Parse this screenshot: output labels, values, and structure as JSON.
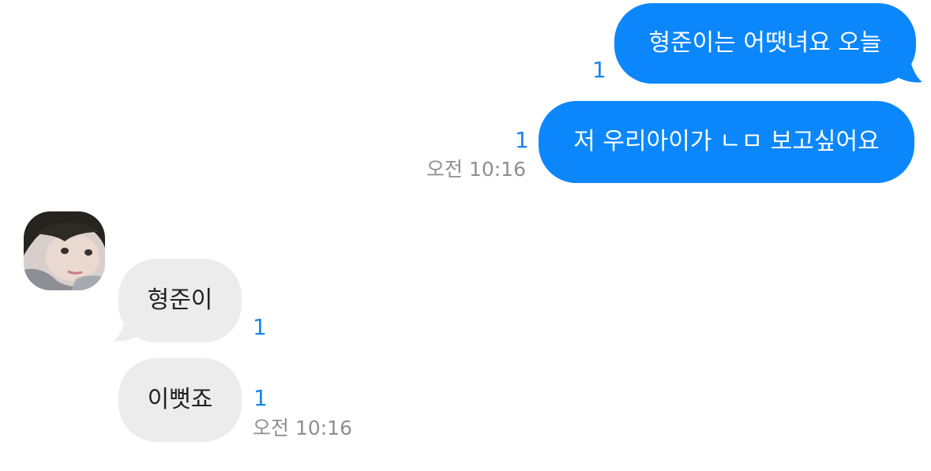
{
  "conversation": {
    "outgoing": [
      {
        "text": "형준이는 어땟녀요 오늘",
        "read": "1"
      },
      {
        "text": "저 우리아이가 ㄴㅁ 보고싶어요",
        "read": "1",
        "time": "오전 10:16"
      }
    ],
    "incoming": [
      {
        "text": "형준이",
        "read": "1"
      },
      {
        "text": "이뻣죠",
        "read": "1",
        "time": "오전 10:16"
      }
    ]
  },
  "colors": {
    "outgoing_bubble": "#0b87fb",
    "incoming_bubble": "#ececed",
    "read_count": "#1a86ea",
    "timestamp": "#8e8e93"
  },
  "icons": {
    "avatar": "contact-photo"
  }
}
